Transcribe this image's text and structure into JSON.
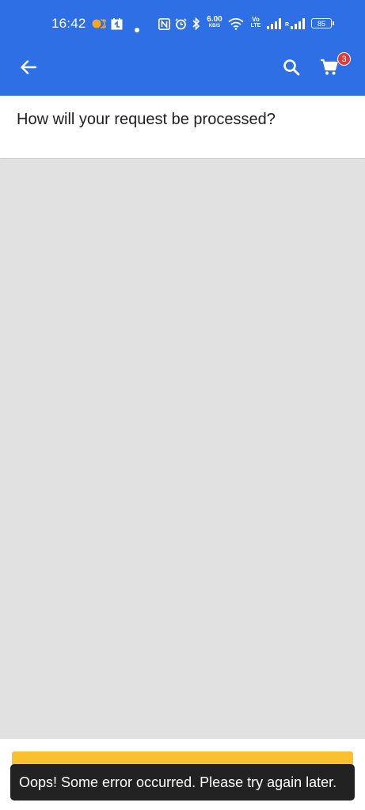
{
  "status_bar": {
    "time": "16:42",
    "network_speed": "6.00",
    "network_speed_unit": "KB/S",
    "volte_label_top": "Vo",
    "volte_label_bottom": "LTE",
    "roaming_label": "R",
    "battery": "85"
  },
  "app_bar": {
    "cart_count": "3",
    "color": "#2f6fe6"
  },
  "header": {
    "title": "How will your request be processed?"
  },
  "primary_button": {
    "color": "#fbc02d"
  },
  "snackbar": {
    "message": "Oops! Some error occurred. Please try again later."
  }
}
